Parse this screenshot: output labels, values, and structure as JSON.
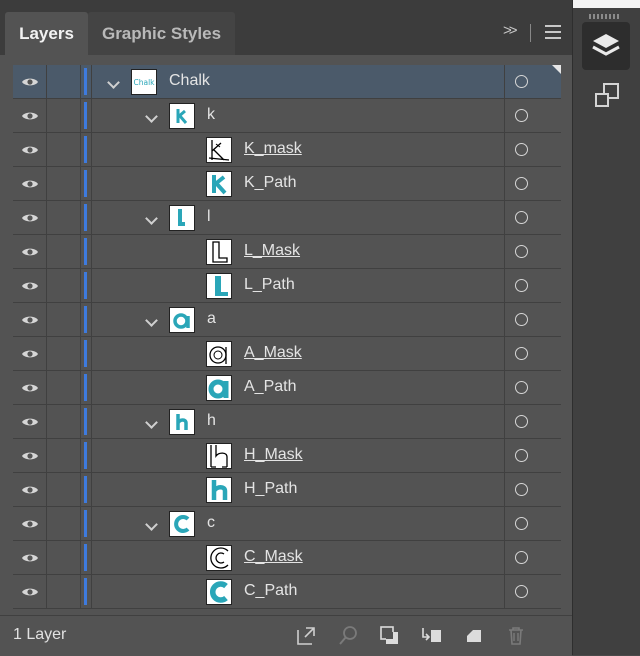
{
  "tabs": [
    {
      "label": "Layers",
      "active": true
    },
    {
      "label": "Graphic Styles",
      "active": false
    }
  ],
  "header_icons": [
    "collapse-icon",
    "panel-menu-icon"
  ],
  "accent_color": "#3e7bde",
  "teal_color": "#2aa6b8",
  "layers": [
    {
      "name": "Chalk",
      "level": 0,
      "expandable": true,
      "selected": true,
      "underline": false,
      "thumb": "chalk"
    },
    {
      "name": "k",
      "level": 1,
      "expandable": true,
      "selected": false,
      "underline": false,
      "thumb": "k"
    },
    {
      "name": "K_mask",
      "level": 2,
      "expandable": false,
      "selected": false,
      "underline": true,
      "thumb": "k-mask"
    },
    {
      "name": "K_Path",
      "level": 2,
      "expandable": false,
      "selected": false,
      "underline": false,
      "thumb": "k-path"
    },
    {
      "name": "l",
      "level": 1,
      "expandable": true,
      "selected": false,
      "underline": false,
      "thumb": "l"
    },
    {
      "name": "L_Mask",
      "level": 2,
      "expandable": false,
      "selected": false,
      "underline": true,
      "thumb": "l-mask"
    },
    {
      "name": "L_Path",
      "level": 2,
      "expandable": false,
      "selected": false,
      "underline": false,
      "thumb": "l-path"
    },
    {
      "name": "a",
      "level": 1,
      "expandable": true,
      "selected": false,
      "underline": false,
      "thumb": "a"
    },
    {
      "name": "A_Mask",
      "level": 2,
      "expandable": false,
      "selected": false,
      "underline": true,
      "thumb": "a-mask"
    },
    {
      "name": "A_Path",
      "level": 2,
      "expandable": false,
      "selected": false,
      "underline": false,
      "thumb": "a-path"
    },
    {
      "name": "h",
      "level": 1,
      "expandable": true,
      "selected": false,
      "underline": false,
      "thumb": "h"
    },
    {
      "name": "H_Mask",
      "level": 2,
      "expandable": false,
      "selected": false,
      "underline": true,
      "thumb": "h-mask"
    },
    {
      "name": "H_Path",
      "level": 2,
      "expandable": false,
      "selected": false,
      "underline": false,
      "thumb": "h-path"
    },
    {
      "name": "c",
      "level": 1,
      "expandable": true,
      "selected": false,
      "underline": false,
      "thumb": "c"
    },
    {
      "name": "C_Mask",
      "level": 2,
      "expandable": false,
      "selected": false,
      "underline": true,
      "thumb": "c-mask"
    },
    {
      "name": "C_Path",
      "level": 2,
      "expandable": false,
      "selected": false,
      "underline": false,
      "thumb": "c-path"
    }
  ],
  "footer": {
    "layer_count": "1 Layer",
    "icons": [
      "export-icon",
      "locate-object-icon",
      "make-clipping-mask-icon",
      "create-sublayer-icon",
      "new-layer-icon",
      "delete-icon"
    ]
  },
  "right_strip": {
    "icons": [
      "layers-panel-icon",
      "artboards-panel-icon"
    ]
  }
}
